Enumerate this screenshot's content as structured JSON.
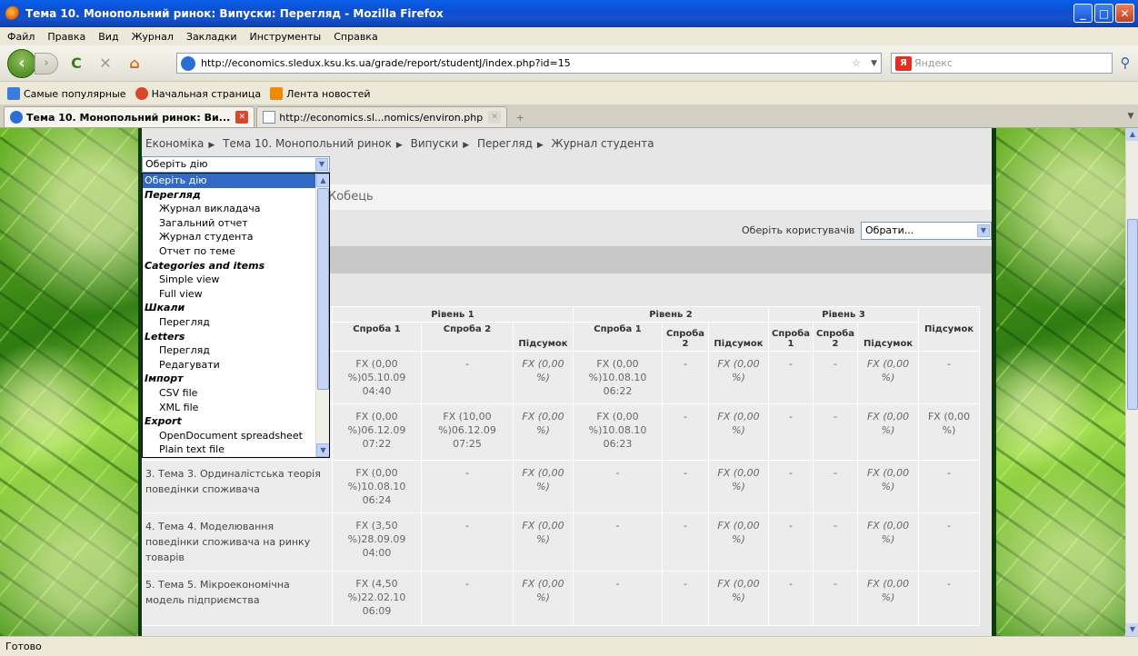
{
  "window": {
    "title": "Тема 10. Монопольний ринок: Випуски: Перегляд - Mozilla Firefox",
    "buttons": {
      "minimize": "_",
      "maximize": "□",
      "close": "✕"
    }
  },
  "menu": [
    "Файл",
    "Правка",
    "Вид",
    "Журнал",
    "Закладки",
    "Инструменты",
    "Справка"
  ],
  "nav": {
    "url": "http://economics.sledux.ksu.ks.ua/grade/report/studentJ/index.php?id=15",
    "search_placeholder": "Яндекс",
    "search_engine_badge": "Я"
  },
  "bookmarks": [
    {
      "label": "Самые популярные",
      "color": "#3b7ddd"
    },
    {
      "label": "Начальная страница",
      "color": "#d9472b"
    },
    {
      "label": "Лента новостей",
      "color": "#f08a00"
    }
  ],
  "tabs": [
    {
      "label": "Тема 10. Монопольний ринок: Ви...",
      "active": true
    },
    {
      "label": "http://economics.sl...nomics/environ.php",
      "active": false
    }
  ],
  "breadcrumb": [
    "Економіка",
    "Тема 10. Монопольний ринок",
    "Випуски",
    "Перегляд",
    "Журнал студента"
  ],
  "action_select": {
    "value": "Оберіть дію",
    "options": [
      {
        "label": "Оберіть дію",
        "type": "sel"
      },
      {
        "label": "Перегляд",
        "type": "grp"
      },
      {
        "label": "Журнал викладача",
        "type": "sub"
      },
      {
        "label": "Загальний отчет",
        "type": "sub"
      },
      {
        "label": "Журнал студента",
        "type": "sub"
      },
      {
        "label": "Отчет по теме",
        "type": "sub"
      },
      {
        "label": "Categories and items",
        "type": "grp"
      },
      {
        "label": "Simple view",
        "type": "sub"
      },
      {
        "label": "Full view",
        "type": "sub"
      },
      {
        "label": "Шкали",
        "type": "grp"
      },
      {
        "label": "Перегляд",
        "type": "sub"
      },
      {
        "label": "Letters",
        "type": "grp"
      },
      {
        "label": "Перегляд",
        "type": "sub"
      },
      {
        "label": "Редагувати",
        "type": "sub"
      },
      {
        "label": "Імпорт",
        "type": "grp"
      },
      {
        "label": "CSV file",
        "type": "sub"
      },
      {
        "label": "XML file",
        "type": "sub"
      },
      {
        "label": "Export",
        "type": "grp"
      },
      {
        "label": "OpenDocument spreadsheet",
        "type": "sub"
      },
      {
        "label": "Plain text file",
        "type": "sub"
      }
    ]
  },
  "user_name_partial": "Кобець",
  "select_users": {
    "label": "Оберіть користувачів",
    "value": "Обрати..."
  },
  "grade_table": {
    "levels": [
      "Рівень 1",
      "Рівень 2",
      "Рівень 3"
    ],
    "headers": [
      "Спроба 1",
      "Спроба 2",
      "Підсумок",
      "Спроба 1",
      "Спроба 2",
      "Підсумок",
      "Спроба 1",
      "Спроба 2",
      "Підсумок",
      "Підсумок"
    ],
    "rows": [
      {
        "name": "",
        "cells": [
          "FX (0,00 %)05.10.09 04:40",
          "-",
          "FX (0,00 %)",
          "FX (0,00 %)10.08.10 06:22",
          "-",
          "FX (0,00 %)",
          "-",
          "-",
          "FX (0,00 %)",
          "-"
        ]
      },
      {
        "name": "",
        "cells": [
          "FX (0,00 %)06.12.09 07:22",
          "FX (10,00 %)06.12.09 07:25",
          "FX (0,00 %)",
          "FX (0,00 %)10.08.10 06:23",
          "-",
          "FX (0,00 %)",
          "-",
          "-",
          "FX (0,00 %)",
          "FX (0,00 %)"
        ]
      },
      {
        "name": "3. Тема 3. Ординалістська теорія поведінки споживача",
        "cells": [
          "FX (0,00 %)10.08.10 06:24",
          "-",
          "FX (0,00 %)",
          "-",
          "-",
          "FX (0,00 %)",
          "-",
          "-",
          "FX (0,00 %)",
          "-"
        ]
      },
      {
        "name": "4. Тема 4. Моделювання поведінки споживача на ринку товарів",
        "cells": [
          "FX (3,50 %)28.09.09 04:00",
          "-",
          "FX (0,00 %)",
          "-",
          "-",
          "FX (0,00 %)",
          "-",
          "-",
          "FX (0,00 %)",
          "-"
        ]
      },
      {
        "name": "5. Тема 5. Мікроекономічна модель підприємства",
        "cells": [
          "FX (4,50 %)22.02.10 06:09",
          "-",
          "FX (0,00 %)",
          "-",
          "-",
          "FX (0,00 %)",
          "-",
          "-",
          "FX (0,00 %)",
          "-"
        ]
      }
    ]
  },
  "status": "Готово"
}
